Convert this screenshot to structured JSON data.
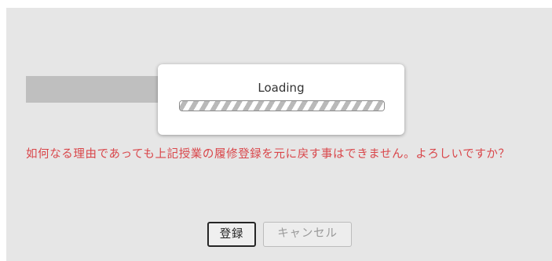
{
  "loading": {
    "text": "Loading",
    "progress_percent": 100
  },
  "dialog": {
    "message": "如何なる理由であっても上記授業の履修登録を元に戻す事はできません。よろしいですか？"
  },
  "buttons": {
    "register": "登録",
    "cancel": "キャンセル"
  },
  "colors": {
    "warning": "#d9464a",
    "dialog_background": "#e6e6e6"
  }
}
